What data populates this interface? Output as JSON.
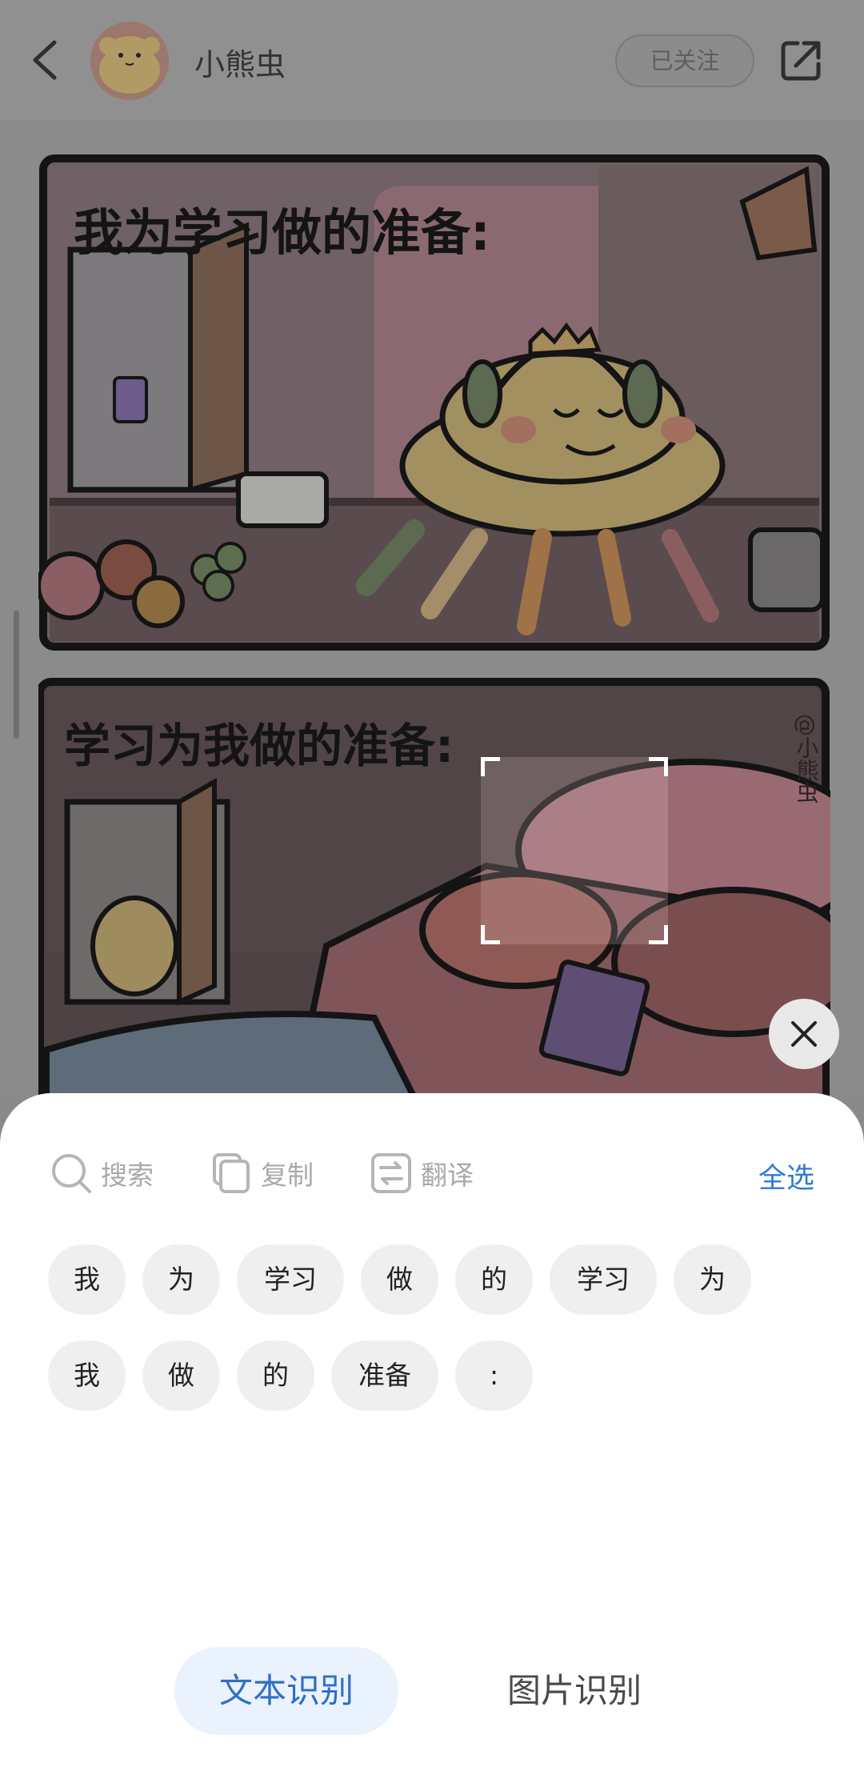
{
  "header": {
    "author_name": "小熊虫",
    "follow_label": "已关注",
    "back_icon": "chevron-left-icon",
    "share_icon": "share-external-icon"
  },
  "comic": {
    "panel1_caption": "我为学习做的准备:",
    "panel2_caption": "学习为我做的准备:",
    "watermark": "@小熊虫"
  },
  "sheet": {
    "actions": [
      {
        "label": "搜索",
        "icon": "search-icon"
      },
      {
        "label": "复制",
        "icon": "copy-icon"
      },
      {
        "label": "翻译",
        "icon": "translate-icon"
      }
    ],
    "select_all": "全选",
    "tokens_row1": [
      "我",
      "为",
      "学习",
      "做",
      "的",
      "学习",
      "为"
    ],
    "tokens_row2": [
      "我",
      "做",
      "的",
      "准备",
      ":"
    ],
    "modes": [
      {
        "label": "文本识别",
        "active": true
      },
      {
        "label": "图片识别",
        "active": false
      }
    ]
  },
  "colors": {
    "accent": "#2f7bd4",
    "overlay": "#8a8a8a",
    "token_bg": "#efefef"
  }
}
